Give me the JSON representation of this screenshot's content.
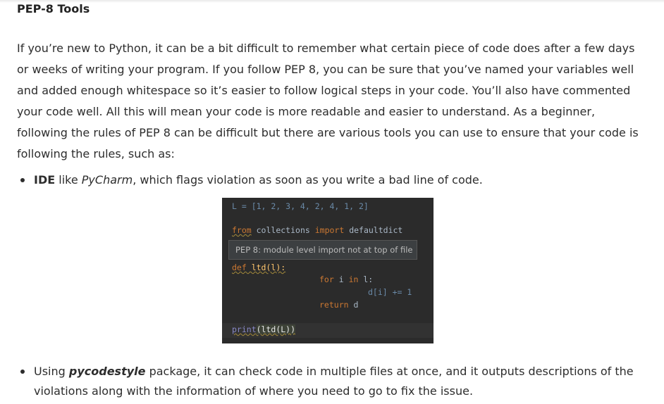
{
  "heading": "PEP-8 Tools",
  "paragraph": "If you’re new to Python, it can be a bit difficult to remember what certain piece of code does after a few days or weeks of writing your program. If you follow PEP 8, you can be sure that you’ve named your variables well and added enough whitespace so it’s easier to follow logical steps in your code. You’ll also have commented your code well. All this will mean your code is more readable and easier to understand. As a beginner, following the rules of PEP 8 can be difficult but there are various tools you can use to ensure that your code is following the rules, such as:",
  "bullet1": {
    "bold": "IDE",
    "pre": " like ",
    "italic": "PyCharm",
    "post": ", which flags violation as soon as you write a bad line of code."
  },
  "bullet2": {
    "pre": "Using ",
    "bold_italic": "pycodestyle",
    "post": " package, it can check code in multiple files at once, and it outputs descriptions of the violations along with the information of where you need to go to fix the issue."
  },
  "code": {
    "line1": "L = [1, 2, 3, 4, 2, 4, 1, 2]",
    "line2_kw1": "from",
    "line2_mid": " collections ",
    "line2_kw2": "import",
    "line2_end": " defaultdict",
    "tooltip": "PEP 8: module level import not at top of file",
    "line3_kw": "def",
    "line3_rest": " ltd(l):",
    "line4_kw1": "for",
    "line4_mid": " i ",
    "line4_kw2": "in",
    "line4_end": " l:",
    "line5": "d[i] += 1",
    "line6_kw": "return",
    "line6_end": " d",
    "line7_fn": "print",
    "line7_args": "(ltd(L))"
  }
}
